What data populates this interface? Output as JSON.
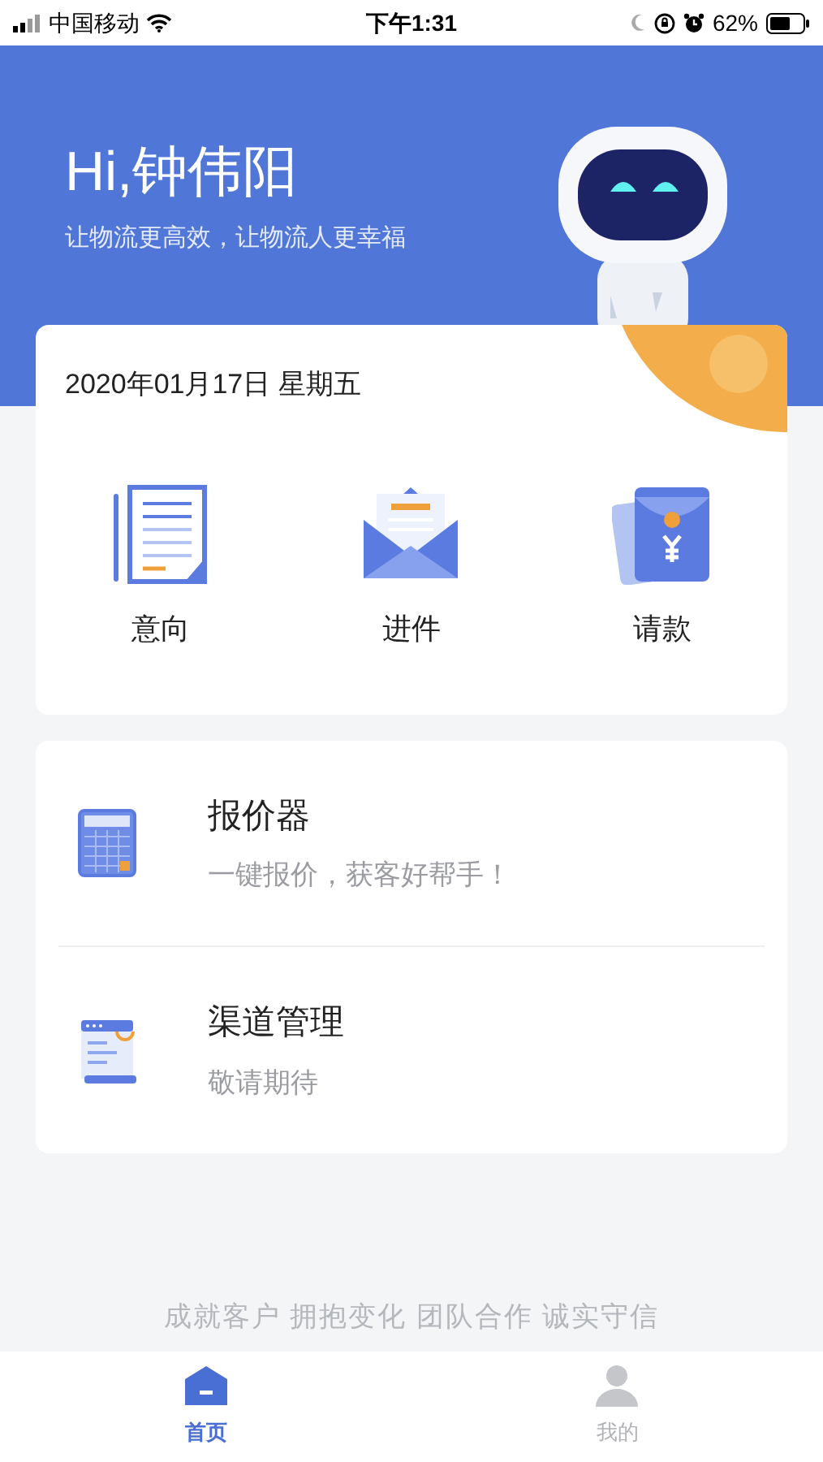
{
  "status_bar": {
    "carrier": "中国移动",
    "time": "下午1:31",
    "battery": "62%"
  },
  "header": {
    "greeting": "Hi,钟伟阳",
    "slogan": "让物流更高效，让物流人更幸福"
  },
  "date": "2020年01月17日 星期五",
  "shortcuts": [
    {
      "kind": "document",
      "label": "意向"
    },
    {
      "kind": "envelope",
      "label": "进件"
    },
    {
      "kind": "payment",
      "label": "请款"
    }
  ],
  "services": [
    {
      "kind": "calculator",
      "title": "报价器",
      "subtitle": "一键报价，获客好帮手！"
    },
    {
      "kind": "channel",
      "title": "渠道管理",
      "subtitle": "敬请期待"
    }
  ],
  "motto": "成就客户 拥抱变化 团队合作 诚实守信",
  "tabs": [
    {
      "kind": "home",
      "label": "首页",
      "selected": true
    },
    {
      "kind": "profile",
      "label": "我的",
      "selected": false
    }
  ]
}
